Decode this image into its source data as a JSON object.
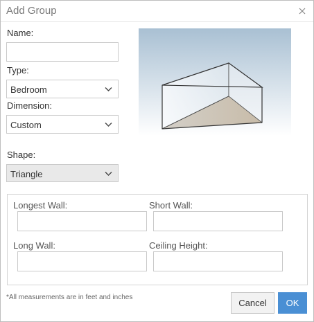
{
  "dialog": {
    "title": "Add Group",
    "close_icon": "close-icon"
  },
  "form": {
    "name_label": "Name:",
    "name_value": "",
    "type_label": "Type:",
    "type_value": "Bedroom",
    "dimension_label": "Dimension:",
    "dimension_value": "Custom",
    "shape_label": "Shape:",
    "shape_value": "Triangle"
  },
  "measurements": {
    "longest_wall_label": "Longest Wall:",
    "longest_wall_value": "",
    "short_wall_label": "Short Wall:",
    "short_wall_value": "",
    "long_wall_label": "Long Wall:",
    "long_wall_value": "",
    "ceiling_height_label": "Ceiling Height:",
    "ceiling_height_value": ""
  },
  "footnote": "*All measurements are in feet and inches",
  "buttons": {
    "cancel": "Cancel",
    "ok": "OK"
  },
  "colors": {
    "accent": "#4a8fd4",
    "disabled_bg": "#e9e9e9",
    "border": "#c9c9c9"
  }
}
